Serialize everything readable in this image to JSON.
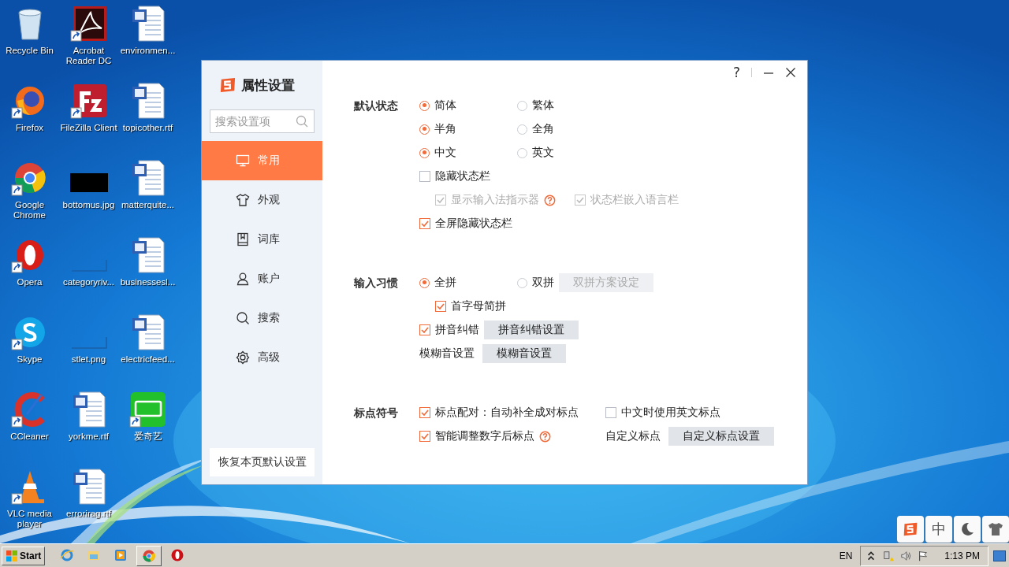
{
  "desktop_icons": [
    {
      "label": "Recycle Bin",
      "kind": "recycle",
      "shortcut": false
    },
    {
      "label": "Firefox",
      "kind": "firefox",
      "shortcut": true
    },
    {
      "label": "Google Chrome",
      "kind": "chrome",
      "shortcut": true
    },
    {
      "label": "Opera",
      "kind": "opera",
      "shortcut": true
    },
    {
      "label": "Skype",
      "kind": "skype",
      "shortcut": true
    },
    {
      "label": "CCleaner",
      "kind": "ccleaner",
      "shortcut": true
    },
    {
      "label": "VLC media player",
      "kind": "vlc",
      "shortcut": true
    },
    {
      "label": "Acrobat Reader DC",
      "kind": "acrobat",
      "shortcut": true
    },
    {
      "label": "FileZilla Client",
      "kind": "filezilla",
      "shortcut": true
    },
    {
      "label": "bottomus.jpg",
      "kind": "dark-image",
      "shortcut": false
    },
    {
      "label": "categoryriv...",
      "kind": "blank-image",
      "shortcut": false
    },
    {
      "label": "stlet.png",
      "kind": "blank-image",
      "shortcut": false
    },
    {
      "label": "yorkme.rtf",
      "kind": "word",
      "shortcut": false
    },
    {
      "label": "errorirag.rtf",
      "kind": "word",
      "shortcut": false
    },
    {
      "label": "environmen...",
      "kind": "word",
      "shortcut": false
    },
    {
      "label": "topicother.rtf",
      "kind": "word",
      "shortcut": false
    },
    {
      "label": "matterquite...",
      "kind": "word",
      "shortcut": false
    },
    {
      "label": "businessesl...",
      "kind": "word",
      "shortcut": false
    },
    {
      "label": "electricfeed...",
      "kind": "word",
      "shortcut": false
    },
    {
      "label": "爱奇艺",
      "kind": "iqiyi",
      "shortcut": true
    }
  ],
  "dialog": {
    "title": "属性设置",
    "help": "?",
    "search": {
      "placeholder": "搜索设置项"
    },
    "nav": [
      {
        "label": "常用",
        "selected": true
      },
      {
        "label": "外观",
        "selected": false
      },
      {
        "label": "词库",
        "selected": false
      },
      {
        "label": "账户",
        "selected": false
      },
      {
        "label": "搜索",
        "selected": false
      },
      {
        "label": "高级",
        "selected": false
      }
    ],
    "restore_button": "恢复本页默认设置",
    "sections": [
      {
        "label": "默认状态",
        "rows": [
          {
            "controls": [
              {
                "kind": "radio",
                "label": "简体",
                "selected": true
              },
              {
                "kind": "radio",
                "label": "繁体",
                "selected": false
              }
            ]
          },
          {
            "controls": [
              {
                "kind": "radio",
                "label": "半角",
                "selected": true
              },
              {
                "kind": "radio",
                "label": "全角",
                "selected": false
              }
            ]
          },
          {
            "controls": [
              {
                "kind": "radio",
                "label": "中文",
                "selected": true
              },
              {
                "kind": "radio",
                "label": "英文",
                "selected": false
              }
            ]
          },
          {
            "controls": [
              {
                "kind": "checkbox",
                "label": "隐藏状态栏",
                "checked": false,
                "disabled": false,
                "help": false
              }
            ],
            "children": [
              {
                "controls": [
                  {
                    "kind": "checkbox",
                    "label": "显示输入法指示器",
                    "checked": true,
                    "disabled": true,
                    "help": true
                  },
                  {
                    "kind": "checkbox",
                    "label": "状态栏嵌入语言栏",
                    "checked": true,
                    "disabled": true,
                    "help": false
                  }
                ]
              }
            ]
          },
          {
            "controls": [
              {
                "kind": "checkbox",
                "label": "全屏隐藏状态栏",
                "checked": true,
                "disabled": false,
                "help": false
              }
            ]
          }
        ]
      },
      {
        "label": "输入习惯",
        "rows": [
          {
            "controls": [
              {
                "kind": "radio",
                "label": "全拼",
                "selected": true
              },
              {
                "kind": "radio",
                "label": "双拼",
                "selected": false
              },
              {
                "kind": "button",
                "label": "双拼方案设定",
                "disabled": true
              }
            ],
            "children": [
              {
                "controls": [
                  {
                    "kind": "checkbox",
                    "label": "首字母简拼",
                    "checked": true,
                    "disabled": false,
                    "help": false
                  }
                ]
              }
            ]
          },
          {
            "controls": [
              {
                "kind": "checkbox",
                "label": "拼音纠错",
                "checked": true,
                "disabled": false,
                "help": false
              },
              {
                "kind": "button",
                "label": "拼音纠错设置",
                "disabled": false
              }
            ]
          },
          {
            "controls": [
              {
                "kind": "text",
                "label": "模糊音设置"
              },
              {
                "kind": "button",
                "label": "模糊音设置",
                "disabled": false
              }
            ]
          }
        ]
      },
      {
        "label": "标点符号",
        "rows": [
          {
            "controls": [
              {
                "kind": "checkbox",
                "label": "标点配对：自动补全成对标点",
                "checked": true,
                "disabled": false,
                "help": false
              },
              {
                "kind": "checkbox",
                "label": "中文时使用英文标点",
                "checked": false,
                "disabled": false,
                "help": false
              }
            ]
          },
          {
            "controls": [
              {
                "kind": "checkbox",
                "label": "智能调整数字后标点",
                "checked": true,
                "disabled": false,
                "help": true
              },
              {
                "kind": "text",
                "label": "自定义标点"
              },
              {
                "kind": "button",
                "label": "自定义标点设置",
                "disabled": false
              }
            ]
          }
        ]
      }
    ]
  },
  "ime_toolbar": [
    {
      "kind": "logo"
    },
    {
      "kind": "text",
      "label": "中"
    },
    {
      "kind": "moon"
    },
    {
      "kind": "shirt"
    }
  ],
  "taskbar": {
    "start": "Start",
    "apps": [
      {
        "kind": "ie",
        "active": false
      },
      {
        "kind": "folder",
        "active": false
      },
      {
        "kind": "media",
        "active": false
      },
      {
        "kind": "chrome",
        "active": true
      },
      {
        "kind": "opera",
        "active": false
      }
    ],
    "language": "EN",
    "clock": "1:13 PM"
  }
}
